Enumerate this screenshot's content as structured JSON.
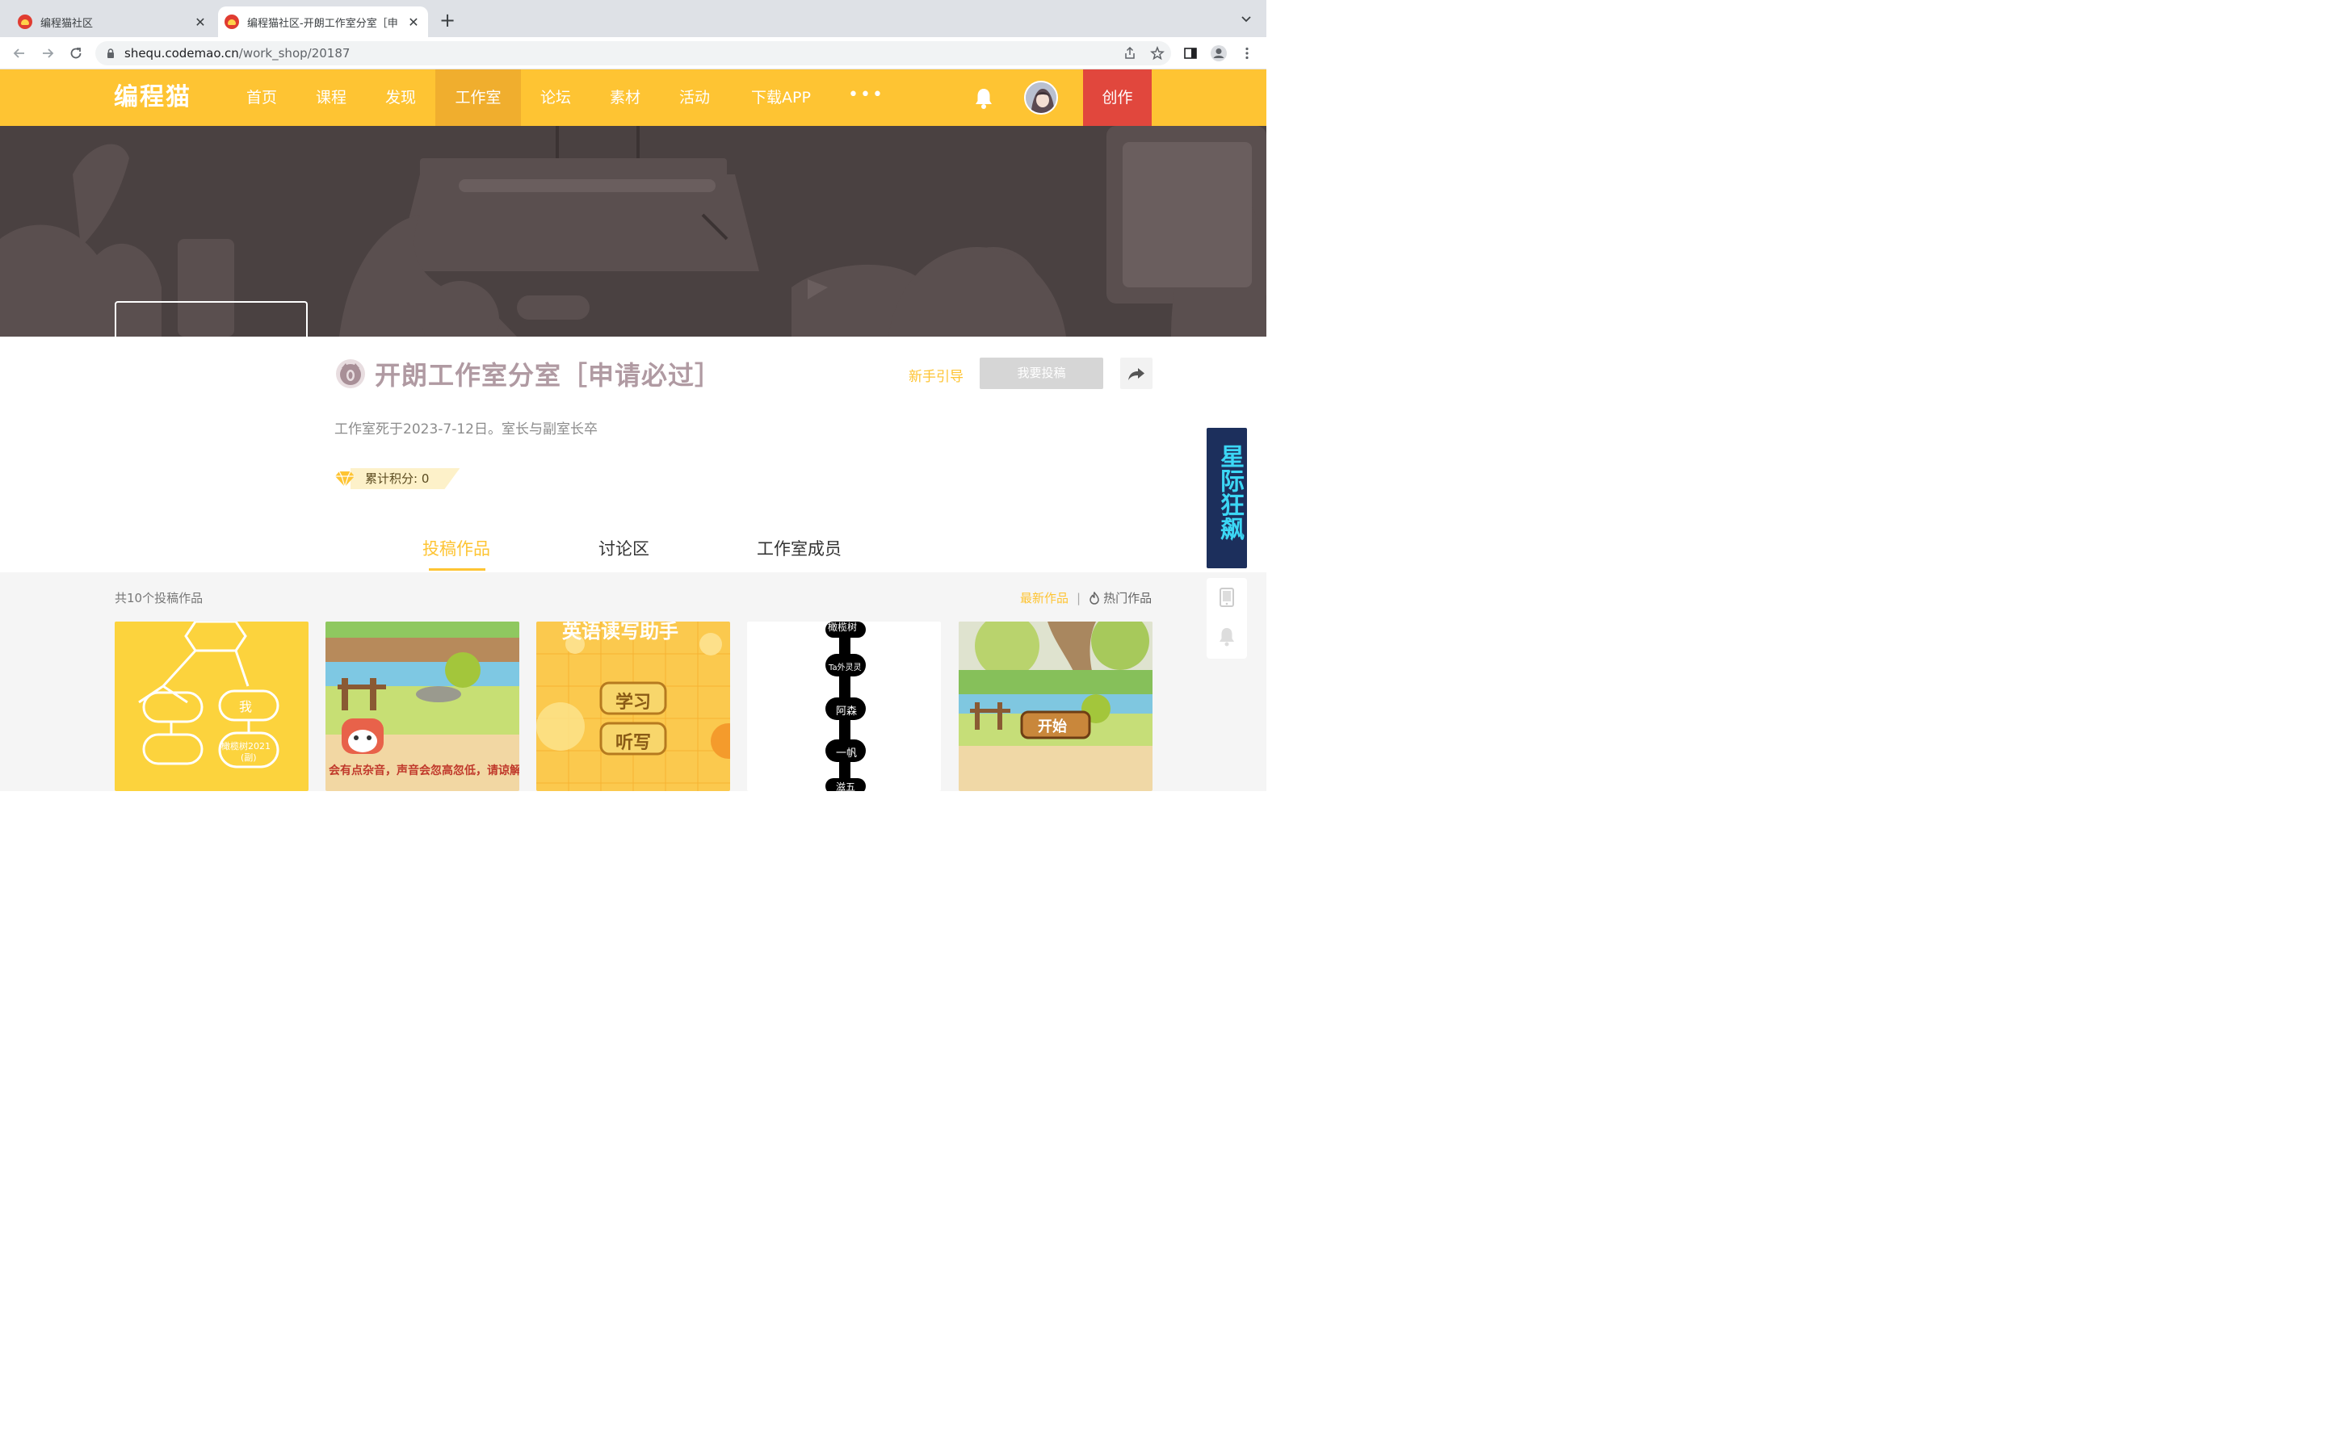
{
  "browser": {
    "tabs": [
      {
        "title": "编程猫社区",
        "active": false
      },
      {
        "title": "编程猫社区-开朗工作室分室［申",
        "active": true
      }
    ],
    "new_tab": "+",
    "url_domain": "shequ.codemao.cn",
    "url_path": "/work_shop/20187"
  },
  "header": {
    "logo": "编程猫",
    "nav": [
      "首页",
      "课程",
      "发现",
      "工作室",
      "论坛",
      "素材",
      "活动",
      "下载APP"
    ],
    "more": "•••",
    "create": "创作",
    "colors": {
      "brand": "#fec433",
      "active": "#f0ae2e",
      "create": "#e1473d"
    }
  },
  "studio": {
    "name": "开朗工作室分室［申请必过］",
    "guide": "新手引导",
    "submit": "我要投稿",
    "description": "工作室死于2023-7-12日。室长与副室长卒",
    "points_label": "累计积分: 0"
  },
  "tabs": [
    "投稿作品",
    "讨论区",
    "工作室成员"
  ],
  "works": {
    "count": "共10个投稿作品",
    "sort_latest": "最新作品",
    "sort_sep": "|",
    "sort_hot": "热门作品",
    "cards": [
      {
        "labels": [
          "我",
          "橄榄树2021",
          "(副)"
        ]
      },
      {
        "title": "会有点杂音，声音会忽高忽低，请谅解"
      },
      {
        "labels": [
          "英语读写助手",
          "学习",
          "听写"
        ]
      },
      {
        "labels": [
          "橄榄树",
          "Ta外灵灵",
          "阿森",
          "一帆",
          "滋五"
        ]
      },
      {
        "labels": [
          "开始"
        ]
      }
    ]
  },
  "side_ad": {
    "text": "星际狂飙"
  }
}
